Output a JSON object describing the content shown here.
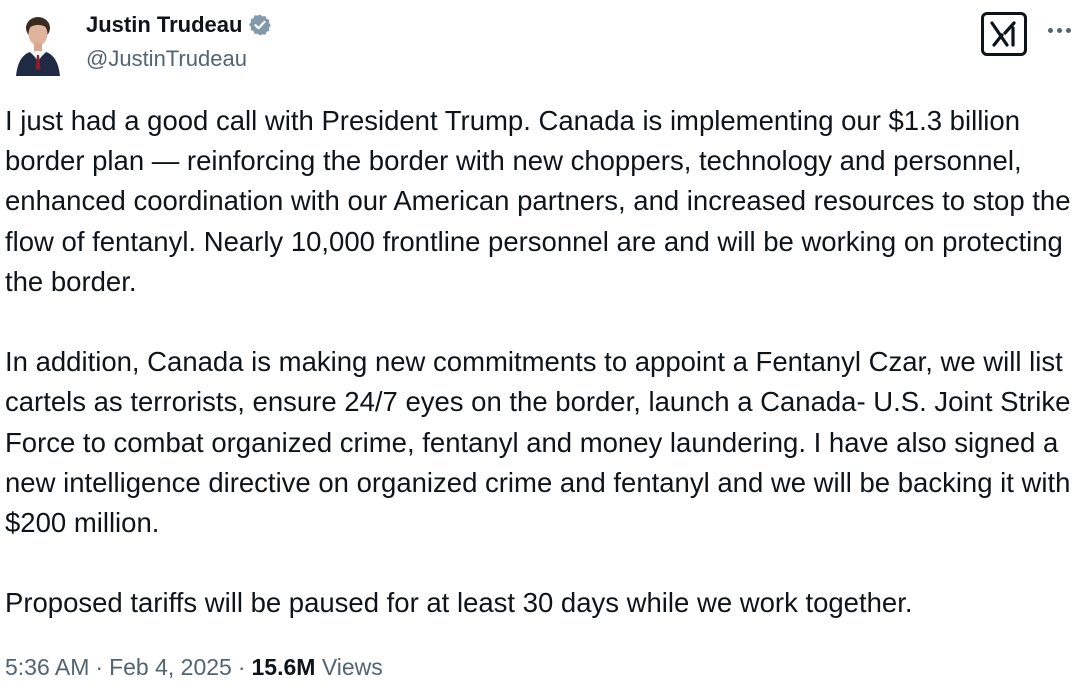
{
  "author": {
    "display_name": "Justin Trudeau",
    "handle": "@JustinTrudeau",
    "verified_badge_color": "#829aab",
    "avatar_icon": "person-photo-avatar"
  },
  "header_icons": {
    "brand_logo": "x-logo-icon",
    "menu": "more-options-icon"
  },
  "tweet": {
    "paragraphs": [
      "I just had a good call with President Trump. Canada is implementing our $1.3 billion border plan — reinforcing the border with new choppers, technology and personnel, enhanced coordination with our American partners, and increased resources to stop the flow of fentanyl. Nearly 10,000 frontline personnel are and will be working on protecting the border.",
      "In addition, Canada is making new commitments to appoint a Fentanyl Czar, we will list cartels as terrorists, ensure 24/7 eyes on the border, launch a Canada- U.S. Joint Strike Force to combat organized crime, fentanyl and money laundering. I have also signed a new intelligence directive on organized crime and fentanyl and we will be backing it with $200 million.",
      "Proposed tariffs will be paused for at least 30 days while we work together."
    ]
  },
  "meta": {
    "time": "5:36 AM",
    "separator": "·",
    "date": "Feb 4, 2025",
    "views_count": "15.6M",
    "views_label": "Views"
  },
  "colors": {
    "text_primary": "#0f1419",
    "text_secondary": "#536471",
    "background": "#ffffff"
  }
}
